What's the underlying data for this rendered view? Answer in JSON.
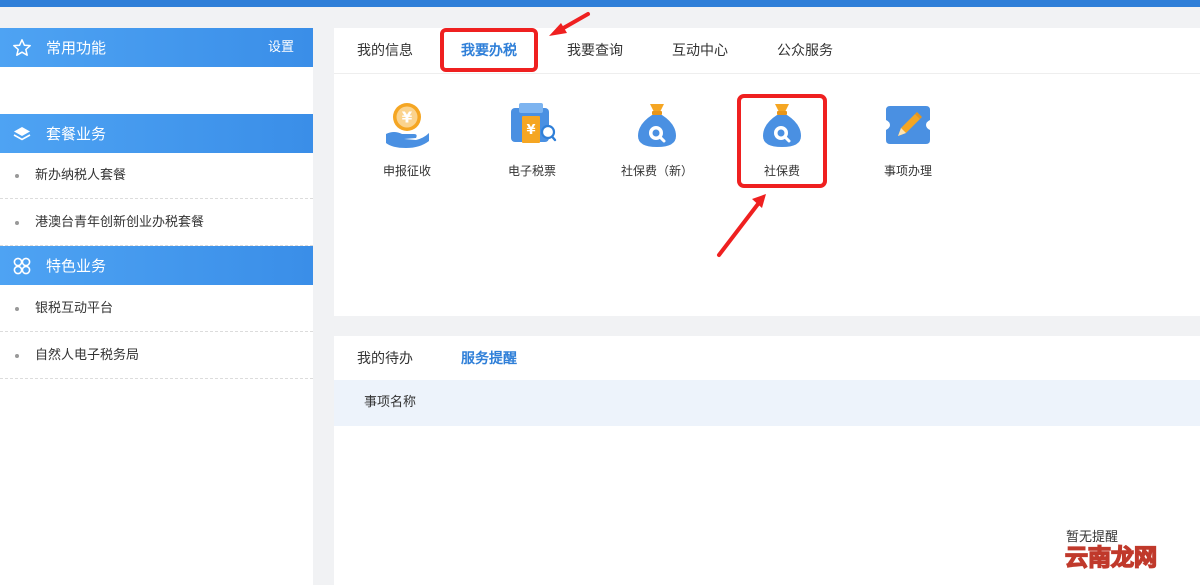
{
  "sidebar": {
    "common": {
      "title": "常用功能",
      "settings_label": "设置"
    },
    "packages": {
      "title": "套餐业务",
      "items": [
        {
          "label": "新办纳税人套餐"
        },
        {
          "label": "港澳台青年创新创业办税套餐"
        }
      ]
    },
    "featured": {
      "title": "特色业务",
      "items": [
        {
          "label": "银税互动平台"
        },
        {
          "label": "自然人电子税务局"
        }
      ]
    }
  },
  "top_tabs": [
    {
      "label": "我的信息"
    },
    {
      "label": "我要办税"
    },
    {
      "label": "我要查询"
    },
    {
      "label": "互动中心"
    },
    {
      "label": "公众服务"
    }
  ],
  "active_top_tab": "我要办税",
  "tiles": [
    {
      "label": "申报征收",
      "icon": "coin-hand-icon"
    },
    {
      "label": "电子税票",
      "icon": "tax-ticket-icon"
    },
    {
      "label": "社保费（新）",
      "icon": "money-bag-search-icon"
    },
    {
      "label": "社保费",
      "icon": "money-bag-search-icon"
    },
    {
      "label": "事项办理",
      "icon": "pencil-ticket-icon"
    }
  ],
  "bottom_tabs": [
    {
      "label": "我的待办"
    },
    {
      "label": "服务提醒"
    }
  ],
  "active_bottom_tab": "服务提醒",
  "table": {
    "column_header": "事项名称",
    "empty_note": "暂无提醒"
  },
  "watermark": "云南龙网",
  "colors": {
    "accent_blue": "#2f7fd8",
    "sidebar_header": "#3a8ee8",
    "highlight_red": "#ef2020",
    "icon_orange": "#f5a623",
    "icon_blue": "#4a90e2"
  }
}
